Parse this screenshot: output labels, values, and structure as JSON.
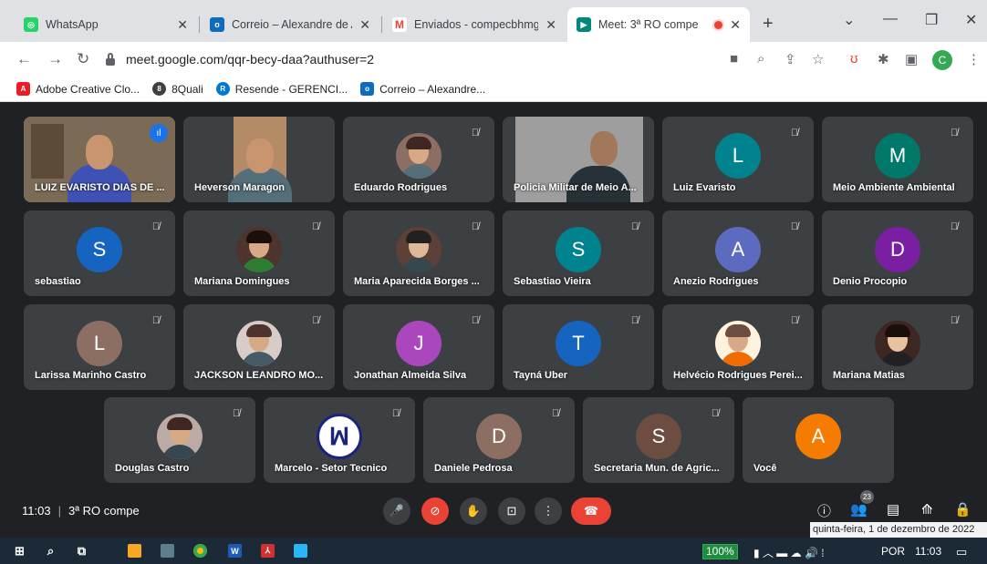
{
  "browser": {
    "tabs": [
      {
        "title": "WhatsApp",
        "favicon_color": "#25d366",
        "glyph": "◎"
      },
      {
        "title": "Correio – Alexandre de Ar",
        "favicon_color": "#0f6cbd",
        "glyph": "o"
      },
      {
        "title": "Enviados - compecbhmg@",
        "favicon_color": "#ea4335",
        "glyph": "M"
      },
      {
        "title": "Meet: 3ª RO compe",
        "favicon_color": "#00897b",
        "glyph": "▶",
        "active": true,
        "recording": true
      }
    ],
    "url": "meet.google.com/qqr-becy-daa?authuser=2",
    "profile_initial": "C",
    "bookmarks": [
      {
        "label": "Adobe Creative Clo...",
        "color": "#ed1c24",
        "glyph": "A"
      },
      {
        "label": "8Quali",
        "color": "#3c4043",
        "glyph": "8"
      },
      {
        "label": "Resende - GERENCI...",
        "color": "#0078d4",
        "glyph": "R"
      },
      {
        "label": "Correio – Alexandre...",
        "color": "#0f6cbd",
        "glyph": "o"
      }
    ]
  },
  "meet": {
    "meeting_time": "11:03",
    "meeting_name": "3ª RO compe",
    "participants_count": "23",
    "tooltip": "quinta-feira, 1 de dezembro de 2022",
    "participants": [
      {
        "name": "LUIZ EVARISTO DIAS DE ...",
        "kind": "video",
        "speaking": true
      },
      {
        "name": "Heverson Maragon",
        "kind": "video"
      },
      {
        "name": "Eduardo Rodrigues",
        "kind": "photo",
        "muted": true
      },
      {
        "name": "Policia Militar de Meio A...",
        "kind": "video"
      },
      {
        "name": "Luiz Evaristo",
        "kind": "initial",
        "initial": "L",
        "color": "#00838f",
        "muted": true
      },
      {
        "name": "Meio Ambiente Ambiental",
        "kind": "initial",
        "initial": "M",
        "color": "#00796b",
        "muted": true
      },
      {
        "name": "sebastiao",
        "kind": "initial",
        "initial": "S",
        "color": "#1565c0",
        "muted": true
      },
      {
        "name": "Mariana Domingues",
        "kind": "photo",
        "muted": true
      },
      {
        "name": "Maria Aparecida Borges ...",
        "kind": "photo",
        "muted": true
      },
      {
        "name": "Sebastiao Vieira",
        "kind": "initial",
        "initial": "S",
        "color": "#00838f",
        "muted": true
      },
      {
        "name": "Anezio Rodrigues",
        "kind": "initial",
        "initial": "A",
        "color": "#5c6bc0",
        "muted": true
      },
      {
        "name": "Denio Procopio",
        "kind": "initial",
        "initial": "D",
        "color": "#7b1fa2",
        "muted": true
      },
      {
        "name": "Larissa Marinho Castro",
        "kind": "initial",
        "initial": "L",
        "color": "#8d6e63",
        "muted": true
      },
      {
        "name": "JACKSON LEANDRO MO...",
        "kind": "photo",
        "muted": true
      },
      {
        "name": "Jonathan Almeida Silva",
        "kind": "initial",
        "initial": "J",
        "color": "#ab47bc",
        "muted": true
      },
      {
        "name": "Tayná Uber",
        "kind": "initial",
        "initial": "T",
        "color": "#1565c0",
        "muted": true
      },
      {
        "name": "Helvécio Rodrigues Perei...",
        "kind": "photo",
        "muted": true
      },
      {
        "name": "Mariana Matias",
        "kind": "photo",
        "muted": true
      },
      {
        "name": "Douglas Castro",
        "kind": "photo",
        "muted": true
      },
      {
        "name": "Marcelo - Setor Tecnico",
        "kind": "logo",
        "muted": true
      },
      {
        "name": "Daniele Pedrosa",
        "kind": "initial",
        "initial": "D",
        "color": "#8d6e63",
        "muted": true
      },
      {
        "name": "Secretaria Mun. de Agric...",
        "kind": "initial",
        "initial": "S",
        "color": "#6d4c41",
        "muted": true
      },
      {
        "name": "Você",
        "kind": "initial",
        "initial": "A",
        "color": "#f57c00"
      }
    ]
  },
  "taskbar": {
    "battery": "100%",
    "language": "POR",
    "clock": "11:03"
  }
}
